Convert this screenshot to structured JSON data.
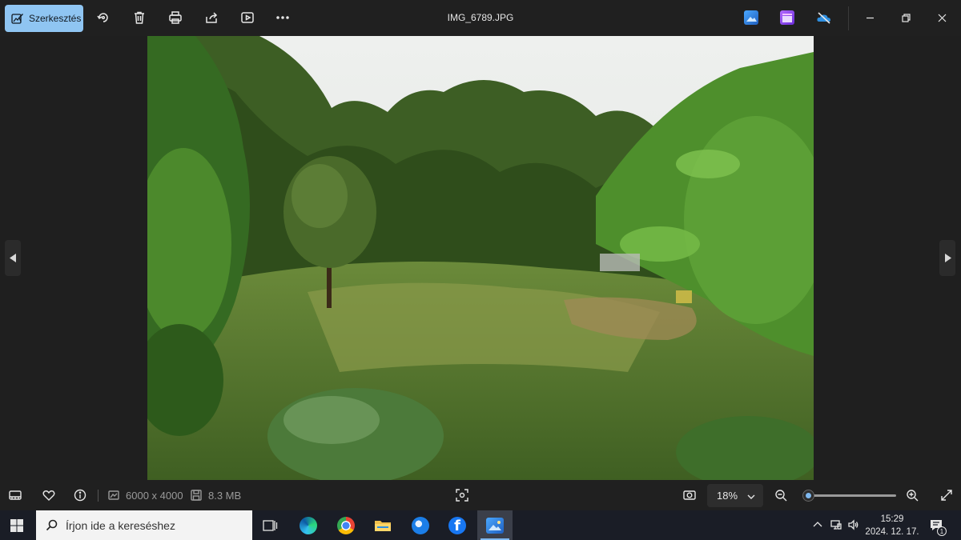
{
  "toolbar": {
    "edit_label": "Szerkesztés",
    "icons": [
      "rotate-icon",
      "delete-icon",
      "print-icon",
      "share-icon",
      "slideshow-icon",
      "more-icon"
    ]
  },
  "window": {
    "title": "IMG_6789.JPG",
    "app_icons": [
      "photos-app-icon",
      "clipchamp-icon",
      "onedrive-offline-icon"
    ]
  },
  "image_info": {
    "dimensions": "6000 x 4000",
    "size": "8.3 MB"
  },
  "zoom": {
    "value": "18%",
    "slider_fraction": 0.04
  },
  "taskbar": {
    "search_placeholder": "Írjon ide a kereséshez",
    "apps": [
      "task-view",
      "edge",
      "chrome",
      "file-explorer",
      "thunderbird",
      "facebook",
      "photos"
    ],
    "time": "15:29",
    "date": "2024. 12. 17.",
    "notification_count": "1"
  },
  "colors": {
    "accent": "#8fc5f2",
    "background": "#1f1f1f",
    "taskbar": "#1a1d26"
  }
}
